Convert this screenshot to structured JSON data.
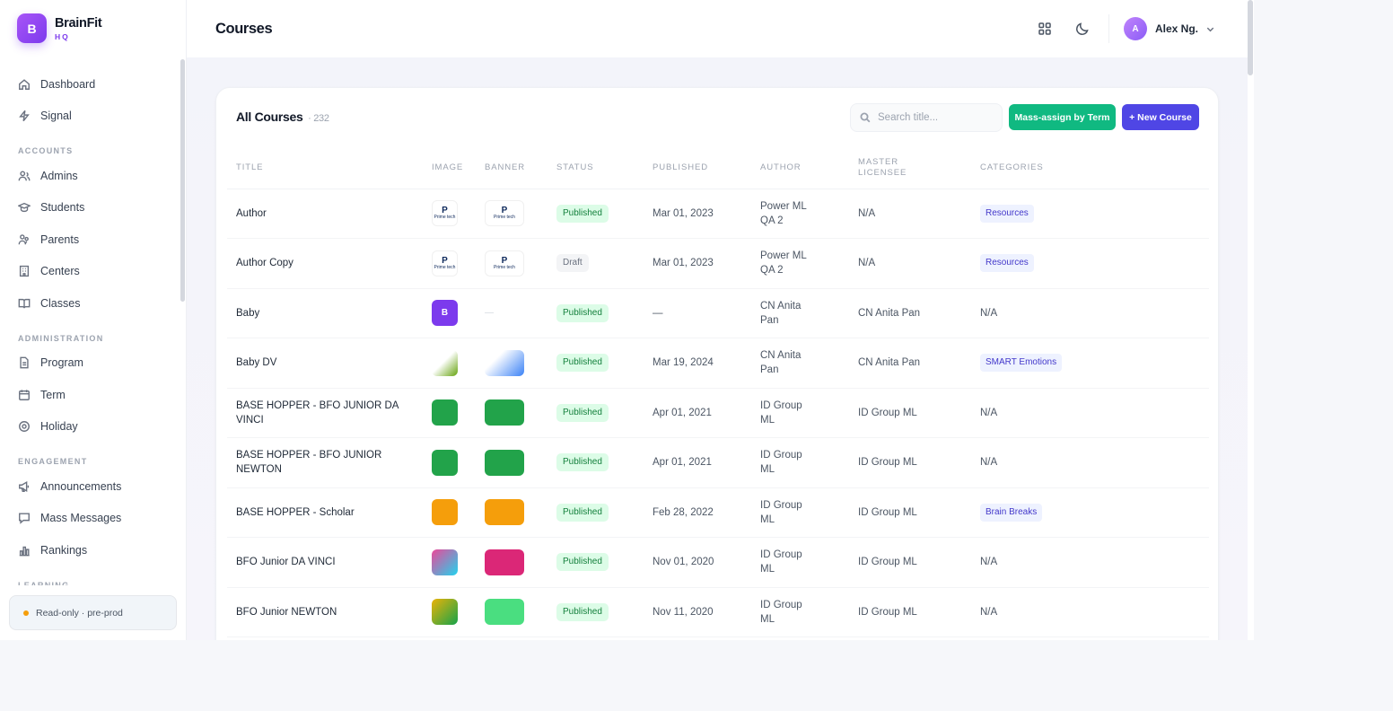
{
  "brand": {
    "name": "BrainFit",
    "sub": "HQ",
    "logo_letter": "B"
  },
  "sidebar": {
    "items": [
      {
        "label": "Dashboard",
        "icon": "home-icon"
      },
      {
        "label": "Signal",
        "icon": "signal-icon"
      }
    ],
    "sections": [
      {
        "label": "ACCOUNTS",
        "items": [
          {
            "label": "Admins",
            "icon": "users-icon"
          },
          {
            "label": "Students",
            "icon": "graduation-cap-icon"
          },
          {
            "label": "Parents",
            "icon": "parents-icon"
          },
          {
            "label": "Centers",
            "icon": "building-icon"
          },
          {
            "label": "Classes",
            "icon": "book-icon"
          }
        ]
      },
      {
        "label": "ADMINISTRATION",
        "items": [
          {
            "label": "Program",
            "icon": "document-icon"
          },
          {
            "label": "Term",
            "icon": "calendar-icon"
          },
          {
            "label": "Holiday",
            "icon": "target-icon"
          }
        ]
      },
      {
        "label": "ENGAGEMENT",
        "items": [
          {
            "label": "Announcements",
            "icon": "megaphone-icon"
          },
          {
            "label": "Mass Messages",
            "icon": "message-icon"
          },
          {
            "label": "Rankings",
            "icon": "bar-chart-icon"
          }
        ]
      },
      {
        "label": "LEARNING",
        "items": []
      }
    ],
    "status": "Read-only · pre-prod"
  },
  "header": {
    "title": "Courses",
    "user_initial": "A",
    "user_name": "Alex Ng."
  },
  "card": {
    "title": "All Courses",
    "count": "· 232",
    "search_placeholder": "Search title...",
    "mass_assign_label": "Mass-assign by Term",
    "new_course_label": "+ New Course"
  },
  "table": {
    "columns": [
      "TITLE",
      "IMAGE",
      "BANNER",
      "STATUS",
      "PUBLISHED",
      "AUTHOR",
      "MASTER LICENSEE",
      "CATEGORIES"
    ],
    "rows": [
      {
        "title": "Author",
        "status": "Published",
        "published": "Mar 01, 2023",
        "author": "Power ML QA 2",
        "licensee": "N/A",
        "category": "Resources"
      },
      {
        "title": "Author Copy",
        "status": "Draft",
        "published": "Mar 01, 2023",
        "author": "Power ML QA 2",
        "licensee": "N/A",
        "category": "Resources"
      },
      {
        "title": "Baby",
        "status": "Published",
        "published": "—",
        "author": "CN Anita Pan",
        "licensee": "CN Anita Pan",
        "category": "N/A"
      },
      {
        "title": "Baby DV",
        "status": "Published",
        "published": "Mar 19, 2024",
        "author": "CN Anita Pan",
        "licensee": "CN Anita Pan",
        "category": "SMART Emotions"
      },
      {
        "title": "BASE HOPPER - BFO JUNIOR DA VINCI",
        "status": "Published",
        "published": "Apr 01, 2021",
        "author": "ID Group ML",
        "licensee": "ID Group ML",
        "category": "N/A"
      },
      {
        "title": "BASE HOPPER - BFO JUNIOR NEWTON",
        "status": "Published",
        "published": "Apr 01, 2021",
        "author": "ID Group ML",
        "licensee": "ID Group ML",
        "category": "N/A"
      },
      {
        "title": "BASE HOPPER - Scholar",
        "status": "Published",
        "published": "Feb 28, 2022",
        "author": "ID Group ML",
        "licensee": "ID Group ML",
        "category": "Brain Breaks"
      },
      {
        "title": "BFO Junior DA VINCI",
        "status": "Published",
        "published": "Nov 01, 2020",
        "author": "ID Group ML",
        "licensee": "ID Group ML",
        "category": "N/A"
      },
      {
        "title": "BFO Junior NEWTON",
        "status": "Published",
        "published": "Nov 11, 2020",
        "author": "ID Group ML",
        "licensee": "ID Group ML",
        "category": "N/A"
      }
    ],
    "image_alt": {
      "prime_p": "P",
      "prime_text": "Prime tech",
      "baby_letter": "B",
      "empty_banner": "—"
    }
  }
}
